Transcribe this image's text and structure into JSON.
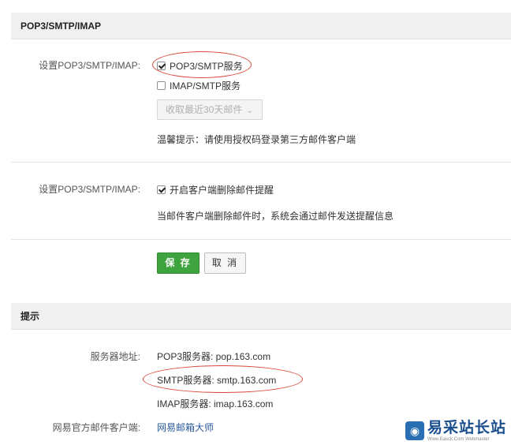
{
  "section1": {
    "title": "POP3/SMTP/IMAP",
    "row1": {
      "label": "设置POP3/SMTP/IMAP:",
      "pop3_smtp": {
        "label": "POP3/SMTP服务",
        "checked": true
      },
      "imap_smtp": {
        "label": "IMAP/SMTP服务",
        "checked": false
      },
      "receive_select": {
        "value": "收取最近30天邮件"
      },
      "hint": "温馨提示：请使用授权码登录第三方邮件客户端"
    },
    "row2": {
      "label": "设置POP3/SMTP/IMAP:",
      "delete_alert": {
        "label": "开启客户端删除邮件提醒",
        "checked": true
      },
      "hint": "当邮件客户端删除邮件时，系统会通过邮件发送提醒信息"
    },
    "actions": {
      "save_label": "保 存",
      "cancel_label": "取 消"
    }
  },
  "section2": {
    "title": "提示",
    "server_label": "服务器地址:",
    "pop3": "POP3服务器: pop.163.com",
    "smtp": "SMTP服务器: smtp.163.com",
    "imap": "IMAP服务器: imap.163.com",
    "client_label": "网易官方邮件客户端:",
    "client_link": "网易邮箱大师"
  },
  "watermark": {
    "title": "易采站长站",
    "subtitle": "Www.Easck.Com Webmaster"
  },
  "colors": {
    "save_button": "#3fa33f",
    "annotation": "#d9463a",
    "link": "#2b5b9b"
  }
}
